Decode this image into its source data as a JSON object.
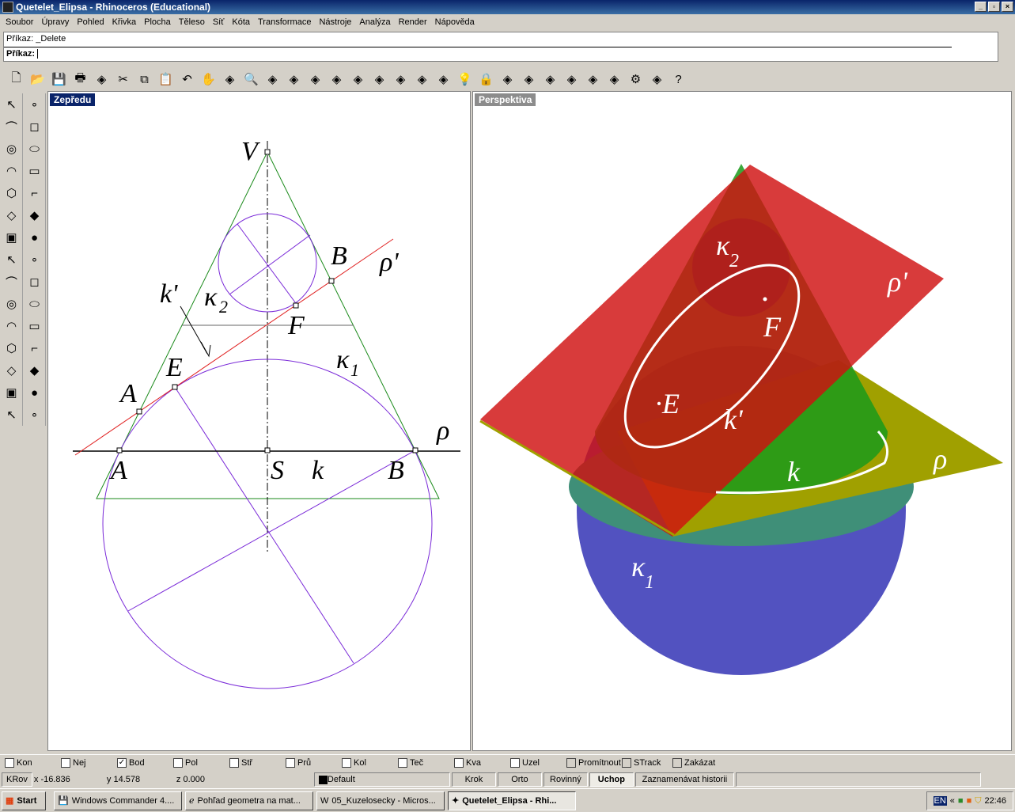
{
  "window": {
    "title": "Quetelet_Elipsa - Rhinoceros (Educational)",
    "controls": [
      "_",
      "▫",
      "×"
    ]
  },
  "menu": [
    "Soubor",
    "Úpravy",
    "Pohled",
    "Křivka",
    "Plocha",
    "Těleso",
    "Síť",
    "Kóta",
    "Transformace",
    "Nástroje",
    "Analýza",
    "Render",
    "Nápověda"
  ],
  "command": {
    "history": "Příkaz: _Delete",
    "prompt": "Příkaz:",
    "value": ""
  },
  "toolbar": [
    "new-icon",
    "open-icon",
    "save-icon",
    "print-icon",
    "import-icon",
    "cut-icon",
    "copy-icon",
    "paste-icon",
    "undo-icon",
    "pan-icon",
    "rotate-view-icon",
    "zoom-icon",
    "zoom-window-icon",
    "zoom-extents-icon",
    "zoom-selected-icon",
    "redo-view-icon",
    "four-viewports-icon",
    "car-icon",
    "grid-icon",
    "cplane-icon",
    "point-icon",
    "light-icon",
    "lock-icon",
    "layer-icon",
    "color-wheel-icon",
    "wireframe-sphere-icon",
    "mesh-sphere-icon",
    "render-sphere-icon",
    "light-spot-icon",
    "settings-icon",
    "options-icon",
    "help-icon"
  ],
  "left_tools": [
    "select-icon",
    "point-icon",
    "polyline-icon",
    "control-points-icon",
    "circle-icon",
    "ellipse-icon",
    "arc-icon",
    "rectangle-icon",
    "polygon-icon",
    "fillet-icon",
    "surface-icon",
    "surface-edit-icon",
    "box-icon",
    "sphere-icon",
    "cylinder-icon",
    "mesh-icon",
    "explode-icon",
    "split-icon",
    "dimension-icon",
    "text-dim-icon",
    "boolean-icon",
    "group-icon",
    "curve-tools-icon",
    "offset-icon",
    "text-icon",
    "transform-icon",
    "array-icon",
    "analyze-icon",
    "render-icon",
    "history-icon"
  ],
  "viewports": {
    "front": {
      "label": "Zepředu",
      "labels": {
        "V": "V",
        "B1": "B",
        "rho1": "ρ'",
        "k1": "k'",
        "kappa2": "κ",
        "kappa2_sub": "2",
        "F": "F",
        "E": "E",
        "kappa1": "κ",
        "kappa1_sub": "1",
        "A1": "A",
        "rho": "ρ",
        "A": "A",
        "S": "S",
        "k": "k",
        "B": "B"
      }
    },
    "perspective": {
      "label": "Perspektiva",
      "labels": {
        "kappa2": "κ",
        "kappa2_sub": "2",
        "rho1": "ρ'",
        "F": "F",
        "E": "·E",
        "k1": "k'",
        "rho": "ρ",
        "k": "k",
        "kappa1": "κ",
        "kappa1_sub": "1"
      }
    }
  },
  "colors": {
    "viewport_active": "#0a246a",
    "viewport_inactive": "#808080",
    "cone": "#1a8a1a",
    "circle": "#7a2ad8",
    "plane_red": "#d01010",
    "plane_yellow": "#a0a000",
    "sphere": "#5252c0"
  },
  "snaps": [
    {
      "label": "Kon",
      "checked": false
    },
    {
      "label": "Nej",
      "checked": false
    },
    {
      "label": "Bod",
      "checked": true
    },
    {
      "label": "Pol",
      "checked": false
    },
    {
      "label": "Stř",
      "checked": false
    },
    {
      "label": "Prů",
      "checked": false
    },
    {
      "label": "Kol",
      "checked": false
    },
    {
      "label": "Teč",
      "checked": false
    },
    {
      "label": "Kva",
      "checked": false
    },
    {
      "label": "Uzel",
      "checked": false
    }
  ],
  "snap_extra": [
    "Promítnout",
    "STrack",
    "Zakázat"
  ],
  "status": {
    "cplane": "KRov",
    "x": "x -16.836",
    "y": "y 14.578",
    "z": "z 0.000",
    "layer": "Default",
    "buttons": [
      "Krok",
      "Orto",
      "Rovinný",
      "Uchop",
      "Zaznamenávat historii"
    ]
  },
  "taskbar": {
    "start": "Start",
    "tasks": [
      "Windows Commander 4....",
      "Pohľad geometra na mat...",
      "05_Kuzelosecky - Micros...",
      "Quetelet_Elipsa - Rhi..."
    ],
    "lang": "EN",
    "time": "22:46"
  }
}
